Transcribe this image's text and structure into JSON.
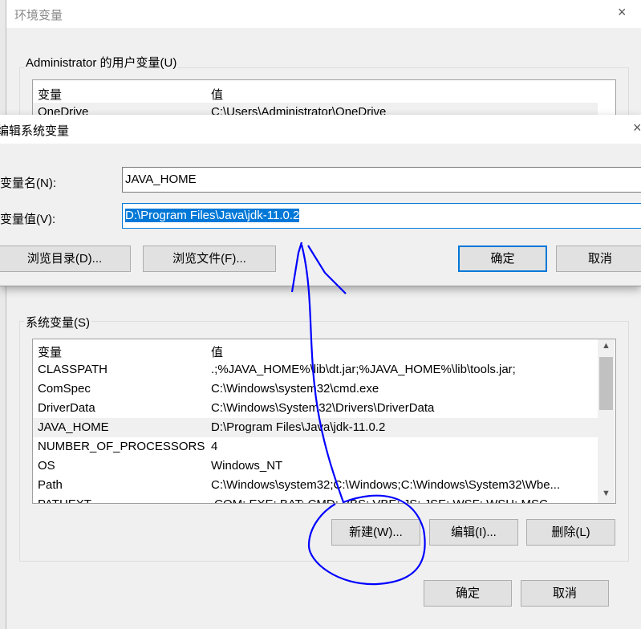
{
  "env_window": {
    "title": "环境变量",
    "user_group_label": "Administrator 的用户变量(U)",
    "user_columns": [
      "变量",
      "值"
    ],
    "user_rows": [
      {
        "name": "OneDrive",
        "value": "C:\\Users\\Administrator\\OneDrive"
      }
    ],
    "system_group_label": "系统变量(S)",
    "system_columns": [
      "变量",
      "值"
    ],
    "system_rows": [
      {
        "name": "CLASSPATH",
        "value": ".;%JAVA_HOME%\\lib\\dt.jar;%JAVA_HOME%\\lib\\tools.jar;"
      },
      {
        "name": "ComSpec",
        "value": "C:\\Windows\\system32\\cmd.exe"
      },
      {
        "name": "DriverData",
        "value": "C:\\Windows\\System32\\Drivers\\DriverData"
      },
      {
        "name": "JAVA_HOME",
        "value": "D:\\Program Files\\Java\\jdk-11.0.2"
      },
      {
        "name": "NUMBER_OF_PROCESSORS",
        "value": "4"
      },
      {
        "name": "OS",
        "value": "Windows_NT"
      },
      {
        "name": "Path",
        "value": "C:\\Windows\\system32;C:\\Windows;C:\\Windows\\System32\\Wbe..."
      },
      {
        "name": "PATHEXT",
        "value": ".COM;.EXE;.BAT;.CMD;.VBS;.VBE;.JS;.JSE;.WSF;.WSH;.MSC"
      }
    ],
    "new_label": "新建(W)...",
    "edit_label": "编辑(I)...",
    "delete_label": "删除(L)",
    "ok_label": "确定",
    "cancel_label": "取消",
    "close_icon": "×"
  },
  "edit_dialog": {
    "title": "编辑系统变量",
    "name_label": "变量名(N):",
    "name_value": "JAVA_HOME",
    "value_label": "变量值(V):",
    "value_value": "D:\\Program Files\\Java\\jdk-11.0.2",
    "browse_dir_label": "浏览目录(D)...",
    "browse_file_label": "浏览文件(F)...",
    "ok_label": "确定",
    "cancel_label": "取消",
    "close_icon": "×"
  },
  "colors": {
    "accent": "#0078d7",
    "annotation": "#0000ff"
  }
}
